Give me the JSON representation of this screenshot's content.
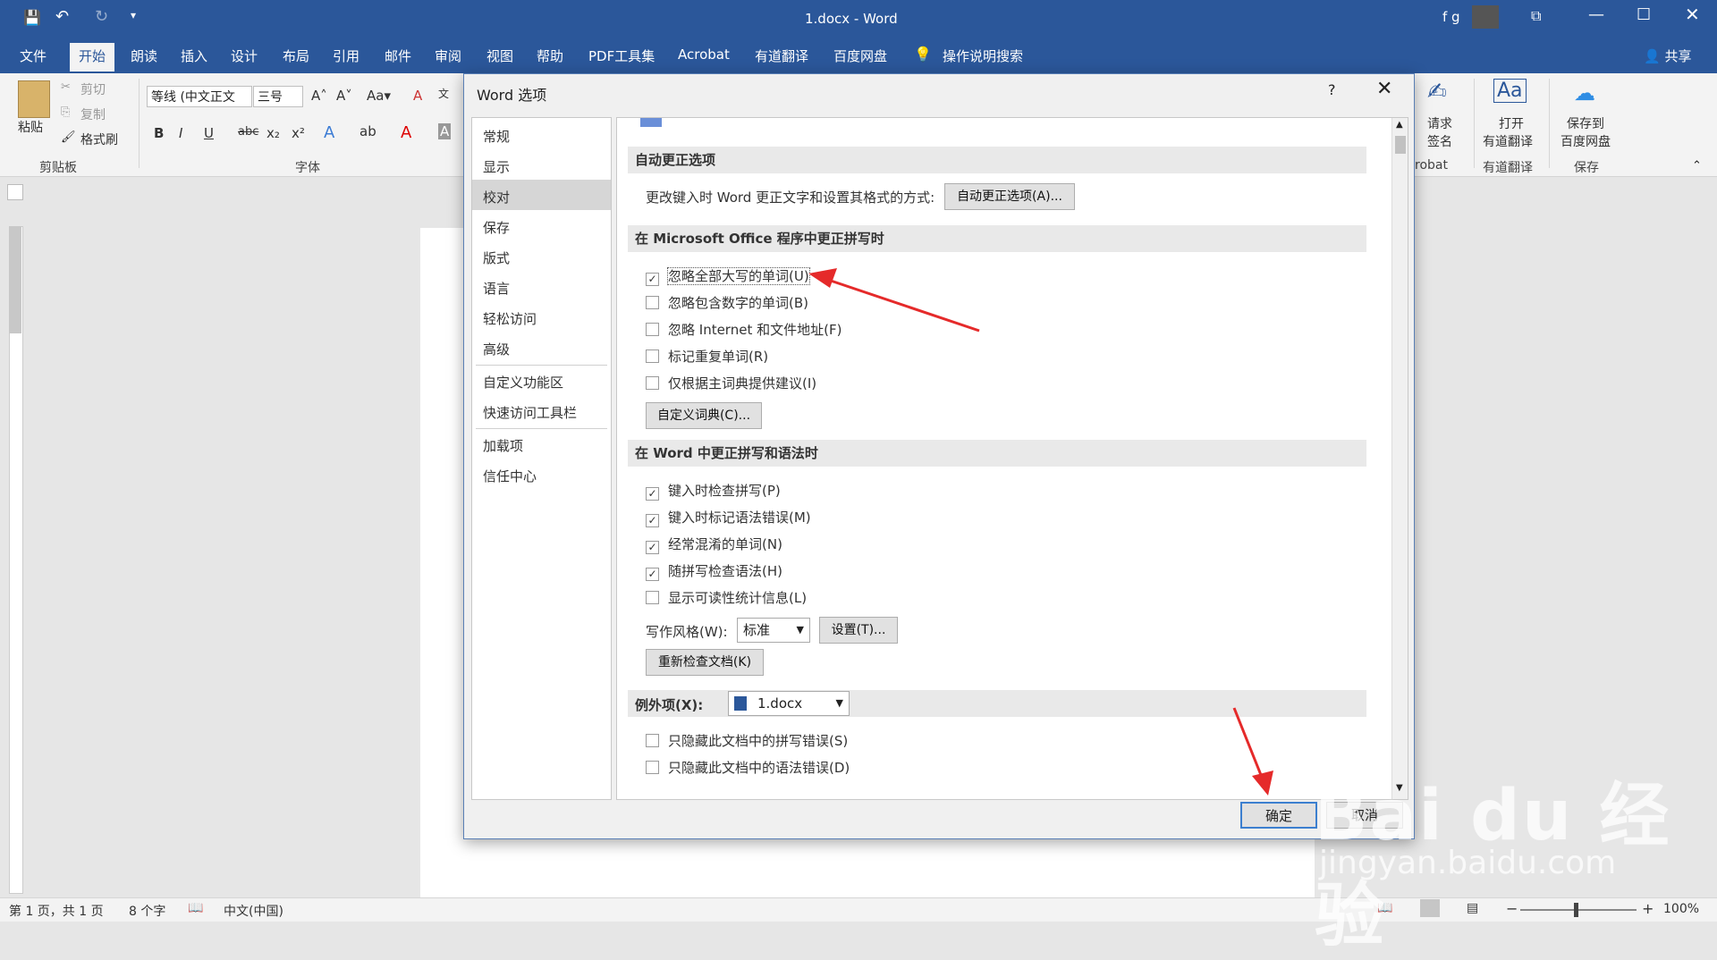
{
  "titlebar": {
    "title": "1.docx  -  Word",
    "user": "f g"
  },
  "tabs": [
    "文件",
    "开始",
    "朗读",
    "插入",
    "设计",
    "布局",
    "引用",
    "邮件",
    "审阅",
    "视图",
    "帮助",
    "PDF工具集",
    "Acrobat",
    "有道翻译",
    "百度网盘",
    "操作说明搜索"
  ],
  "share_label": "共享",
  "ribbon": {
    "paste": "粘贴",
    "cut": "剪切",
    "copy": "复制",
    "format_painter": "格式刷",
    "clipboard_group": "剪贴板",
    "font_group": "字体",
    "font_name": "等线 (中文正文",
    "font_size": "三号",
    "request_sign_1": "请求",
    "request_sign_2": "签名",
    "acrobat_group": "robat",
    "open_youdao_1": "打开",
    "open_youdao_2": "有道翻译",
    "youdao_group": "有道翻译",
    "save_baidu_1": "保存到",
    "save_baidu_2": "百度网盘",
    "save_group": "保存"
  },
  "status": {
    "page": "第 1 页，共 1 页",
    "words": "8 个字",
    "lang": "中文(中国)",
    "zoom": "100%"
  },
  "dialog": {
    "title": "Word 选项",
    "help": "?",
    "nav": [
      "常规",
      "显示",
      "校对",
      "保存",
      "版式",
      "语言",
      "轻松访问",
      "高级",
      "自定义功能区",
      "快速访问工具栏",
      "加载项",
      "信任中心"
    ],
    "nav_selected": "校对",
    "sec_autocorrect": "自动更正选项",
    "autocorrect_desc": "更改键入时 Word 更正文字和设置其格式的方式:",
    "autocorrect_btn": "自动更正选项(A)...",
    "sec_office": "在 Microsoft Office 程序中更正拼写时",
    "office_options": [
      {
        "label": "忽略全部大写的单词(U)",
        "checked": true
      },
      {
        "label": "忽略包含数字的单词(B)",
        "checked": false
      },
      {
        "label": "忽略 Internet 和文件地址(F)",
        "checked": false
      },
      {
        "label": "标记重复单词(R)",
        "checked": false
      },
      {
        "label": "仅根据主词典提供建议(I)",
        "checked": false
      }
    ],
    "custom_dict_btn": "自定义词典(C)...",
    "sec_word": "在 Word 中更正拼写和语法时",
    "word_options": [
      {
        "label": "键入时检查拼写(P)",
        "checked": true
      },
      {
        "label": "键入时标记语法错误(M)",
        "checked": true
      },
      {
        "label": "经常混淆的单词(N)",
        "checked": true
      },
      {
        "label": "随拼写检查语法(H)",
        "checked": true
      },
      {
        "label": "显示可读性统计信息(L)",
        "checked": false
      }
    ],
    "writing_style_label": "写作风格(W):",
    "writing_style_value": "标准",
    "settings_btn": "设置(T)...",
    "recheck_btn": "重新检查文档(K)",
    "exceptions_label": "例外项(X):",
    "exceptions_doc": "1.docx",
    "exception_options": [
      {
        "label": "只隐藏此文档中的拼写错误(S)",
        "checked": false
      },
      {
        "label": "只隐藏此文档中的语法错误(D)",
        "checked": false
      }
    ],
    "ok": "确定",
    "cancel": "取消"
  },
  "watermark": {
    "brand": "Bai du 经验",
    "url": "jingyan.baidu.com"
  },
  "colors": {
    "word_blue": "#2b579a",
    "arrow_red": "#e52a2a"
  }
}
